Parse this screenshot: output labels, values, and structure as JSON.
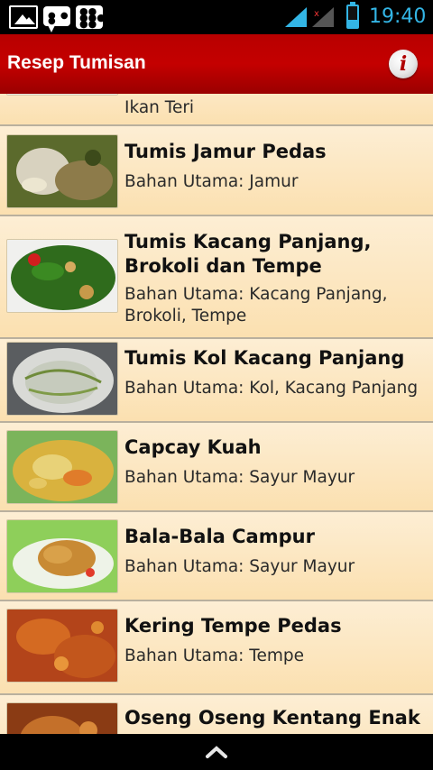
{
  "status_bar": {
    "time": "19:40",
    "icons": [
      "gallery-icon",
      "chat-icon",
      "bbm-icon",
      "signal-icon",
      "signal-no-data-icon",
      "battery-icon"
    ]
  },
  "action_bar": {
    "title": "Resep Tumisan",
    "info_icon_glyph": "i",
    "accent_color": "#c40000"
  },
  "list": {
    "items": [
      {
        "title": "",
        "subtitle": "Ikan Teri",
        "thumb": "food-1"
      },
      {
        "title": "Tumis Jamur Pedas",
        "subtitle": "Bahan Utama: Jamur",
        "thumb": "food-2"
      },
      {
        "title": "Tumis Kacang Panjang, Brokoli dan Tempe",
        "subtitle": "Bahan Utama: Kacang Panjang, Brokoli, Tempe",
        "thumb": "food-3"
      },
      {
        "title": "Tumis Kol Kacang Panjang",
        "subtitle": "Bahan Utama: Kol, Kacang Panjang",
        "thumb": "food-4"
      },
      {
        "title": "Capcay Kuah",
        "subtitle": "Bahan Utama: Sayur Mayur",
        "thumb": "food-5"
      },
      {
        "title": "Bala-Bala Campur",
        "subtitle": "Bahan Utama: Sayur Mayur",
        "thumb": "food-6"
      },
      {
        "title": "Kering Tempe Pedas",
        "subtitle": "Bahan Utama: Tempe",
        "thumb": "food-7"
      },
      {
        "title": "Oseng Oseng Kentang Enak",
        "subtitle": "",
        "thumb": "food-8"
      }
    ]
  },
  "bottom_bar": {
    "icon": "chevron-up-icon"
  }
}
